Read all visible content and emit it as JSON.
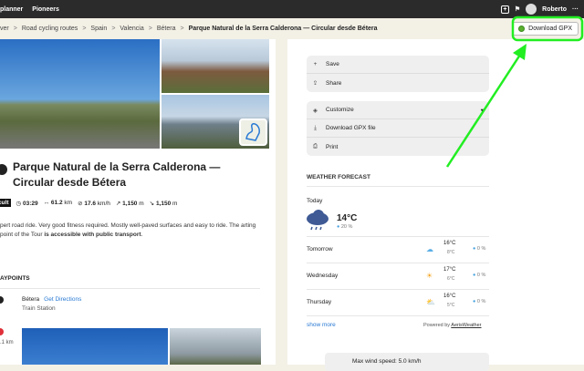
{
  "topbar": {
    "nav": [
      "planner",
      "Pioneers"
    ],
    "user": "Roberto",
    "more": "···"
  },
  "breadcrumb": [
    "ver",
    "Road cycling routes",
    "Spain",
    "Valencia",
    "Bétera"
  ],
  "breadcrumb_current": "Parque Natural de la Serra Calderona — Circular desde Bétera",
  "download_button": "Download GPX",
  "tour": {
    "title": "Parque Natural de la Serra Calderona — Circular desde Bétera",
    "difficulty": "ifficult",
    "duration": "03:29",
    "distance": "61.2",
    "distance_unit": "km",
    "speed": "17.6",
    "speed_unit": "km/h",
    "uphill": "1,150",
    "downhill": "1,150",
    "elev_unit": "m",
    "desc_start": "pert road ride. Very good fitness required. Mostly well-paved surfaces and easy to ride. The arting point of the Tour ",
    "desc_bold": "is accessible with public transport",
    "desc_end": "."
  },
  "waypoints": {
    "heading": "AYPOINTS",
    "first": {
      "name": "Bétera",
      "link": "Get Directions",
      "sub": "Train Station"
    },
    "second_dist": ".1 km"
  },
  "actions1": [
    "Save",
    "Share"
  ],
  "actions2": [
    "Customize",
    "Download GPX file",
    "Print"
  ],
  "weather": {
    "heading": "WEATHER FORECAST",
    "today_label": "Today",
    "today_temp": "14°C",
    "today_precip": "20 %",
    "days": [
      {
        "name": "Tomorrow",
        "icon": "cloud",
        "hi": "16°C",
        "lo": "8°C",
        "precip": "0 %"
      },
      {
        "name": "Wednesday",
        "icon": "sun",
        "hi": "17°C",
        "lo": "6°C",
        "precip": "0 %"
      },
      {
        "name": "Thursday",
        "icon": "partly-cloudy",
        "hi": "16°C",
        "lo": "5°C",
        "precip": "0 %"
      }
    ],
    "show_more": "show more",
    "powered": "Powered by",
    "provider": "AerisWeather"
  },
  "wind": "Max wind speed: 5.0 km/h"
}
